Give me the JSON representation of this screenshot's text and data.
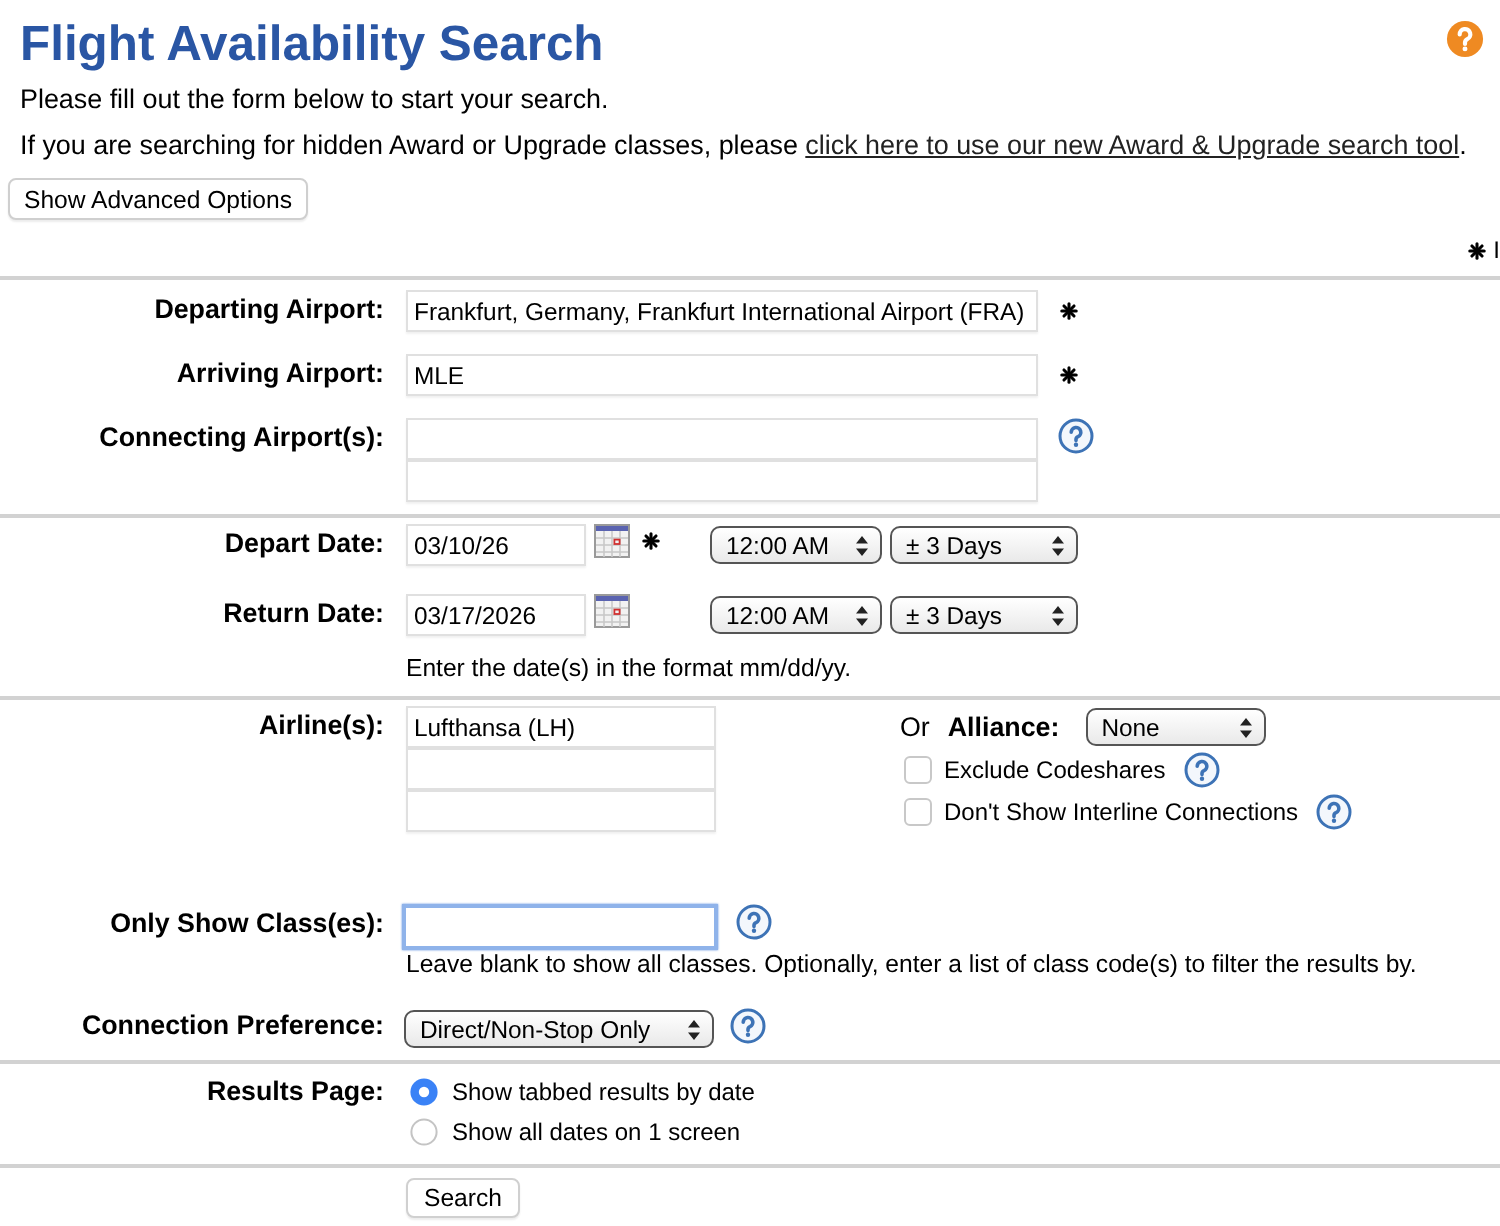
{
  "header": {
    "title": "Flight Availability Search",
    "intro": "Please fill out the form below to start your search.",
    "award_note": "If you are searching for hidden Award or Upgrade classes, please ",
    "award_link": "click here to use our new Award & Upgrade search tool",
    "award_note_end": ".",
    "advanced_button": "Show Advanced Options",
    "legend": "I"
  },
  "airports": [
    {
      "label": "Departing Airport:",
      "required": true,
      "help": false,
      "inputs": [
        {
          "value": "Frankfurt, Germany, Frankfurt International Airport (FRA)",
          "focused": false
        }
      ]
    },
    {
      "label": "Arriving Airport:",
      "required": true,
      "help": false,
      "inputs": [
        {
          "value": "MLE",
          "focused": false
        }
      ]
    },
    {
      "label": "Connecting Airport(s):",
      "required": false,
      "help": true,
      "inputs": [
        {
          "focused": false
        },
        {
          "focused": false
        }
      ]
    }
  ],
  "dates": {
    "rows": [
      {
        "label": "Depart Date:",
        "value": "03/10/26",
        "required": true,
        "time": "12:00 AM",
        "range": "± 3 Days"
      },
      {
        "label": "Return Date:",
        "value": "03/17/2026",
        "required": false,
        "time": "12:00 AM",
        "range": "± 3 Days"
      }
    ],
    "hint": "Enter the date(s) in the format mm/dd/yy."
  },
  "airlines": {
    "label": "Airline(s):",
    "inputs": [
      {
        "value": "Lufthansa (LH)",
        "focused": false
      },
      {
        "focused": false
      },
      {
        "focused": false
      }
    ],
    "or": "Or",
    "alliance_label": "Alliance:",
    "alliance": "None",
    "options": [
      {
        "label": "Exclude Codeshares",
        "checked": false,
        "help": true
      },
      {
        "label": "Don't Show Interline Connections",
        "checked": false,
        "help": true
      }
    ]
  },
  "classes": {
    "label": "Only Show Class(es):",
    "input": {
      "focused": true
    },
    "help": true,
    "hint": "Leave blank to show all classes. Optionally, enter a list of class code(s) to filter the results by."
  },
  "connection": {
    "label": "Connection Preference:",
    "value": "Direct/Non-Stop Only",
    "help": true
  },
  "results": {
    "label": "Results Page:",
    "options": [
      {
        "label": "Show tabbed results by date",
        "selected": true
      },
      {
        "label": "Show all dates on 1 screen",
        "selected": false
      }
    ]
  },
  "search_button": "Search"
}
